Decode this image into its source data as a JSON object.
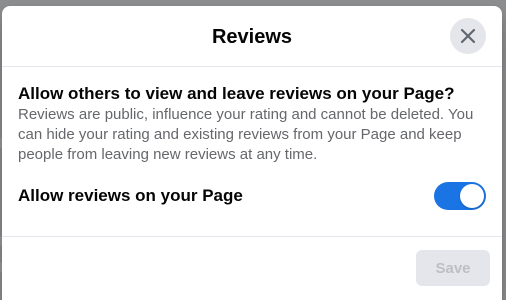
{
  "dialog": {
    "title": "Reviews",
    "close_icon": "close-icon",
    "question": "Allow others to view and leave reviews on your Page?",
    "description": "Reviews are public, influence your rating and cannot be deleted. You can hide your rating and existing reviews from your Page and keep people from leaving new reviews at any time.",
    "toggle": {
      "label": "Allow reviews on your Page",
      "enabled": true,
      "color": "#1b74e4"
    },
    "footer": {
      "save_label": "Save",
      "save_disabled": true
    }
  }
}
